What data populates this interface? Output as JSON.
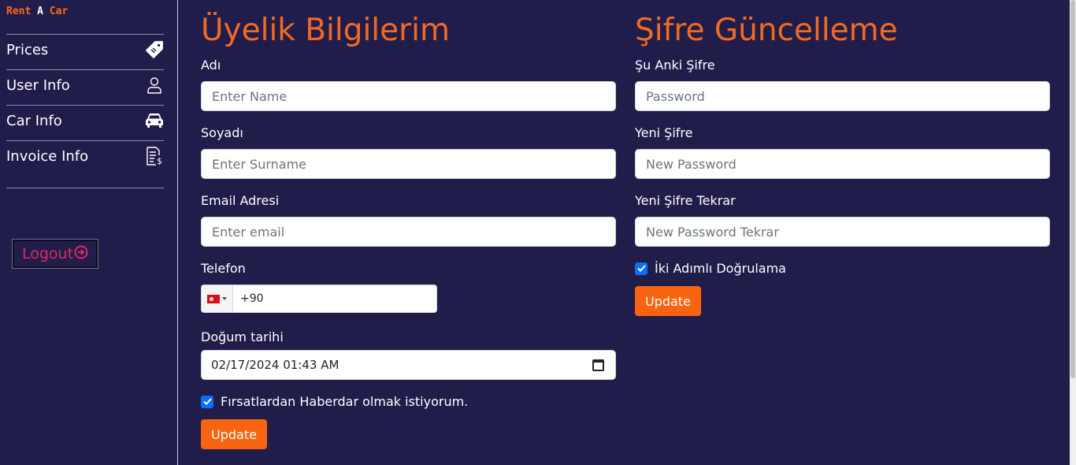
{
  "brand": {
    "part1": "Rent",
    "part2": "A",
    "part3": "Car"
  },
  "sidebar": {
    "items": [
      {
        "label": "Prices",
        "icon": "price-tag-icon"
      },
      {
        "label": "User Info",
        "icon": "user-icon"
      },
      {
        "label": "Car Info",
        "icon": "car-icon"
      },
      {
        "label": "Invoice Info",
        "icon": "invoice-icon"
      }
    ],
    "logout_label": "Logout"
  },
  "profile": {
    "title": "Üyelik Bilgilerim",
    "name_label": "Adı",
    "name_placeholder": "Enter Name",
    "surname_label": "Soyadı",
    "surname_placeholder": "Enter Surname",
    "email_label": "Email Adresi",
    "email_placeholder": "Enter email",
    "phone_label": "Telefon",
    "phone_value": "+90",
    "birth_label": "Doğum tarihi",
    "birth_value": "02/17/2024 01:43 AM",
    "offers_label": "Fırsatlardan Haberdar olmak istiyorum.",
    "offers_checked": true,
    "update_label": "Update"
  },
  "password": {
    "title": "Şifre Güncelleme",
    "current_label": "Şu Anki Şifre",
    "current_placeholder": "Password",
    "new_label": "Yeni Şifre",
    "new_placeholder": "New Password",
    "repeat_label": "Yeni Şifre Tekrar",
    "repeat_placeholder": "New Password Tekrar",
    "twofa_label": "İki Adımlı Doğrulama",
    "twofa_checked": true,
    "update_label": "Update"
  },
  "colors": {
    "background": "#201d4b",
    "accent": "#f26a22",
    "button": "#f8640f",
    "logout": "#e0295f",
    "checkbox": "#0d6efd"
  }
}
